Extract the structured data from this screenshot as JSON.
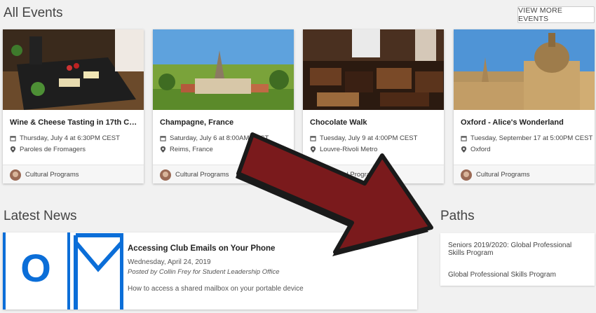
{
  "events": {
    "title": "All Events",
    "view_more": "VIEW MORE EVENTS",
    "cards": [
      {
        "title": "Wine & Cheese Tasting in 17th Ce...",
        "date": "Thursday, July 4 at 6:30PM CEST",
        "location": "Paroles de Fromagers",
        "org": "Cultural Programs"
      },
      {
        "title": "Champagne, France",
        "date": "Saturday, July 6 at 8:00AM CEST",
        "location": "Reims, France",
        "org": "Cultural Programs"
      },
      {
        "title": "Chocolate Walk",
        "date": "Tuesday, July 9 at 4:00PM CEST",
        "location": "Louvre-Rivoli Metro",
        "org": "Cultural Programs"
      },
      {
        "title": "Oxford - Alice's Wonderland",
        "date": "Tuesday, September 17 at 5:00PM CEST",
        "location": "Oxford",
        "org": "Cultural Programs"
      }
    ]
  },
  "news": {
    "title": "Latest News",
    "item": {
      "title": "Accessing Club Emails on Your Phone",
      "date": "Wednesday, April 24, 2019",
      "byline": "Posted by Collin Frey for Student Leadership Office",
      "description": "How to access a shared mailbox on your portable device",
      "logo_letter": "O"
    }
  },
  "paths": {
    "title": "Paths",
    "items": [
      "Seniors 2019/2020: Global Professional Skills Program",
      "Global Professional Skills Program"
    ]
  },
  "icons": {
    "calendar": "calendar-icon",
    "location": "map-pin-icon",
    "arrow": "red-arrow-overlay"
  },
  "colors": {
    "accent_blue": "#0b6ed8",
    "arrow_red": "#7a1a1c",
    "arrow_outline": "#1a1a1a"
  }
}
